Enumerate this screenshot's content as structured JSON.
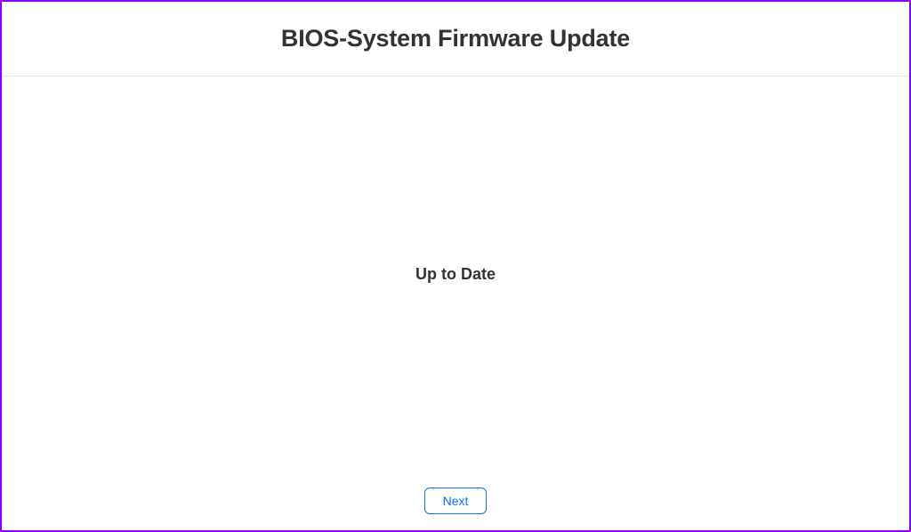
{
  "header": {
    "title": "BIOS-System Firmware Update"
  },
  "main": {
    "status": "Up to Date"
  },
  "footer": {
    "next_label": "Next"
  }
}
